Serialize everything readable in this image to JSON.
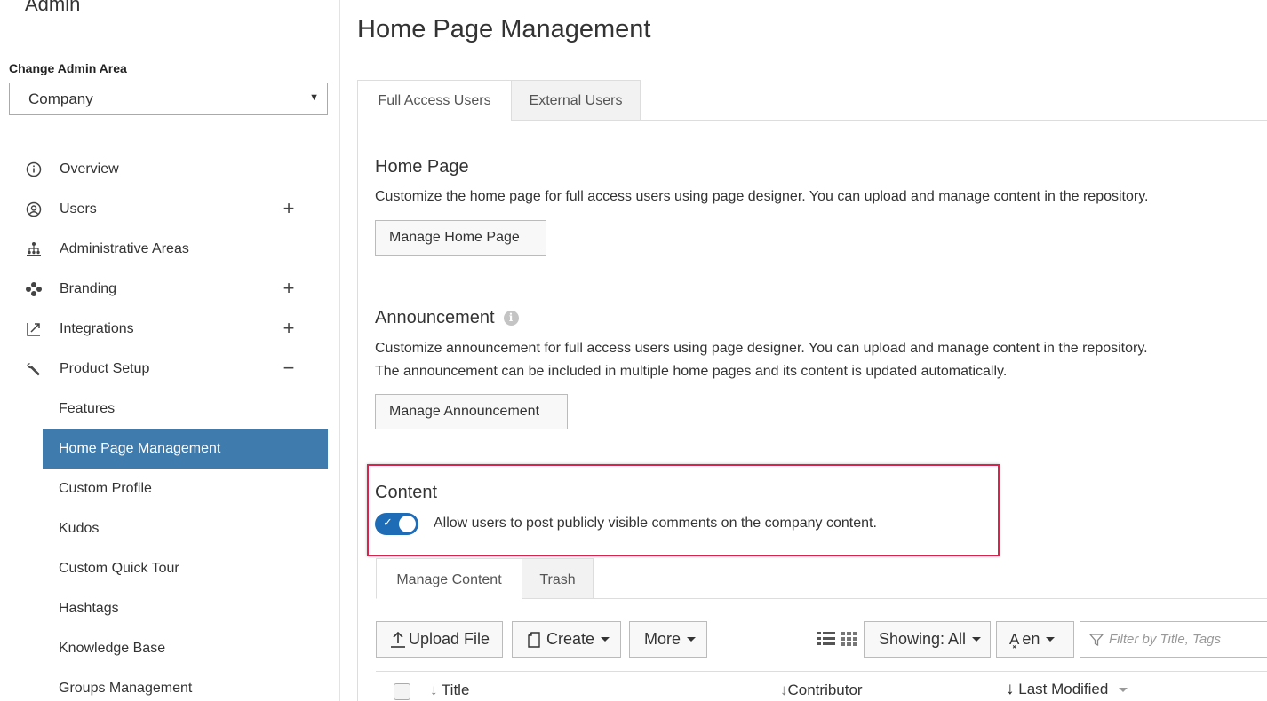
{
  "sidebar": {
    "title": "Admin",
    "area_label": "Change Admin Area",
    "area_value": "Company",
    "items": [
      {
        "label": "Overview",
        "icon": "info-circle-icon",
        "expander": ""
      },
      {
        "label": "Users",
        "icon": "user-circle-icon",
        "expander": "+"
      },
      {
        "label": "Administrative Areas",
        "icon": "hierarchy-icon",
        "expander": ""
      },
      {
        "label": "Branding",
        "icon": "palette-icon",
        "expander": "+"
      },
      {
        "label": "Integrations",
        "icon": "integration-icon",
        "expander": "+"
      },
      {
        "label": "Product Setup",
        "icon": "wrench-icon",
        "expander": "−"
      }
    ],
    "sub_items": [
      {
        "label": "Features"
      },
      {
        "label": "Home Page Management"
      },
      {
        "label": "Custom Profile"
      },
      {
        "label": "Kudos"
      },
      {
        "label": "Custom Quick Tour"
      },
      {
        "label": "Hashtags"
      },
      {
        "label": "Knowledge Base"
      },
      {
        "label": "Groups Management"
      }
    ]
  },
  "main": {
    "title": "Home Page Management",
    "tabs": [
      {
        "label": "Full Access Users"
      },
      {
        "label": "External Users"
      }
    ],
    "home_page": {
      "heading": "Home Page",
      "description": "Customize the home page for full access users using page designer. You can upload and manage content in the repository.",
      "button": "Manage Home Page"
    },
    "announcement": {
      "heading": "Announcement",
      "info_glyph": "i",
      "description_1": "Customize announcement for full access users using page designer. You can upload and manage content in the repository.",
      "description_2": "The announcement can be included in multiple home pages and its content is updated automatically.",
      "button": "Manage Announcement"
    },
    "content": {
      "heading": "Content",
      "toggle_on": true,
      "toggle_label": "Allow users to post publicly visible comments on the company content."
    },
    "content_tabs": [
      {
        "label": "Manage Content"
      },
      {
        "label": "Trash"
      }
    ],
    "toolbar": {
      "upload": "Upload File",
      "create": "Create",
      "more": "More",
      "showing": "Showing: All",
      "language": "en",
      "filter_placeholder": "Filter by Title, Tags"
    },
    "table": {
      "columns": [
        "Title",
        "Contributor",
        "Last Modified"
      ]
    }
  },
  "colors": {
    "active_nav": "#3f7bad",
    "toggle": "#1f6cb6",
    "highlight": "#d7244c"
  }
}
